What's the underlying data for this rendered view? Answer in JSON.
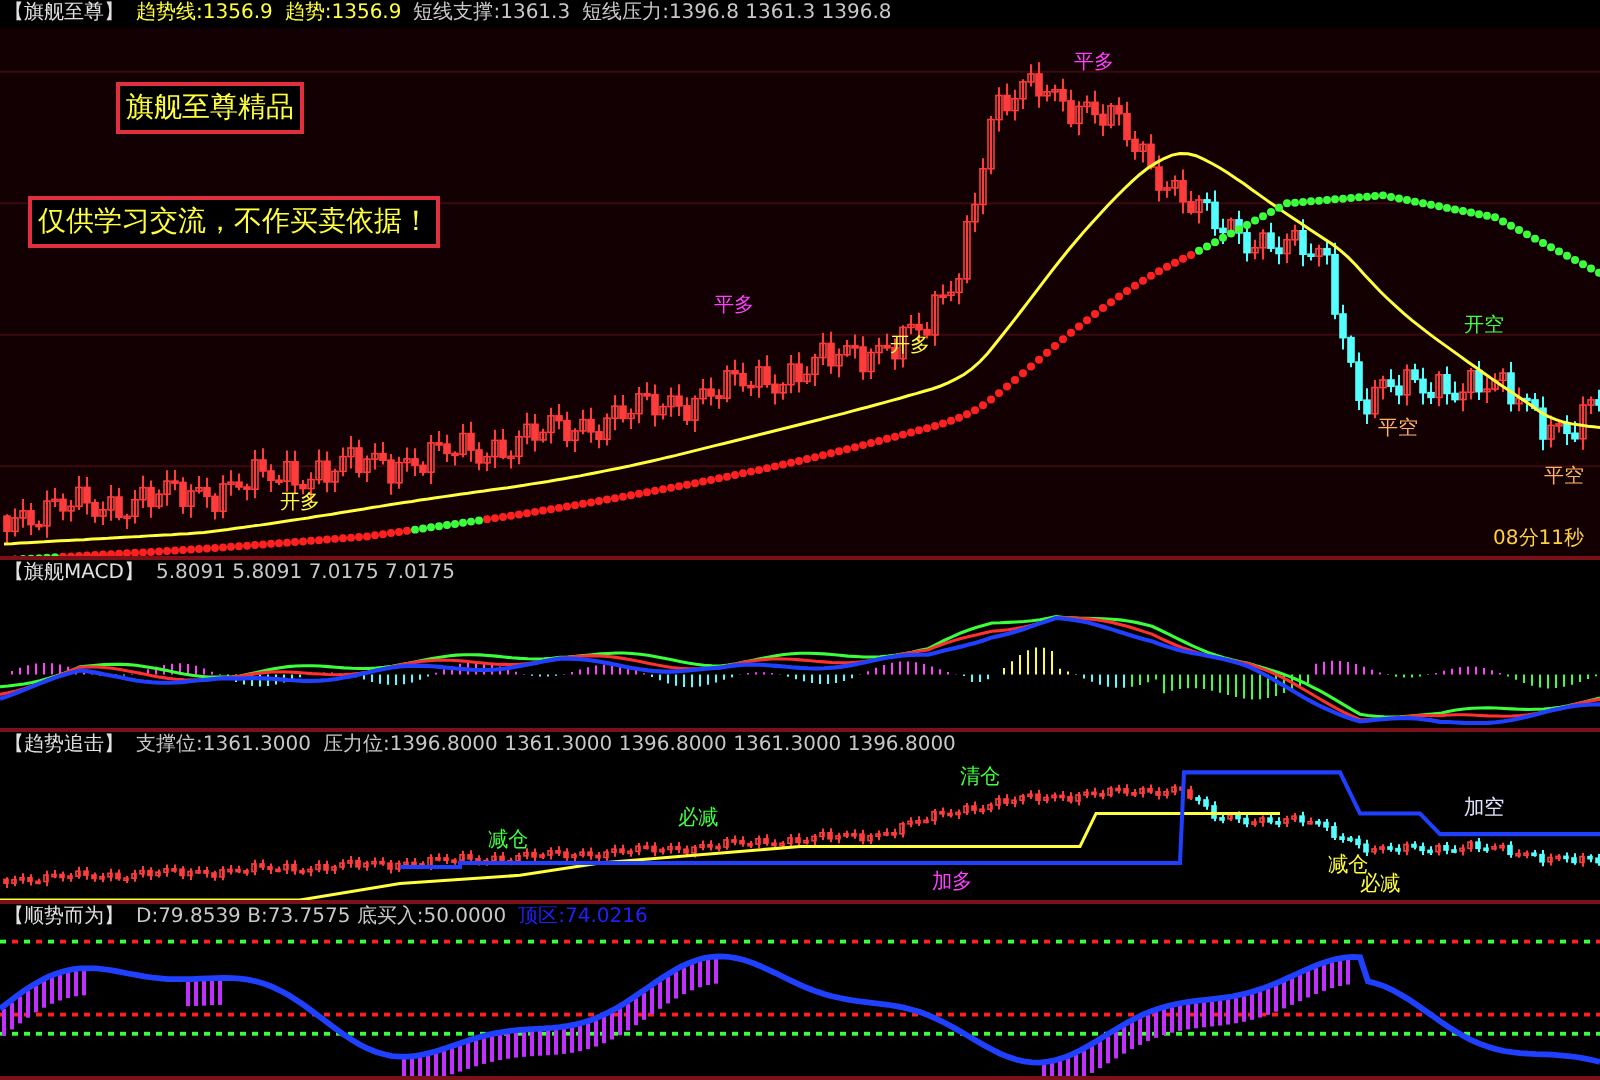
{
  "panels": [
    {
      "kind": "price",
      "header": [
        {
          "text": "【旗舰至尊】",
          "color": "#e0e0e0"
        },
        {
          "text": "趋势线:1356.9",
          "color": "#ffff3c"
        },
        {
          "text": "趋势:1356.9",
          "color": "#ffff3c"
        },
        {
          "text": "短线支撑:1361.3",
          "color": "#c8c8c8"
        },
        {
          "text": "短线压力:1396.8 1361.3 1396.8",
          "color": "#c8c8c8"
        }
      ],
      "notes": [
        "旗舰至尊精品",
        "仅供学习交流，不作买卖依据！"
      ],
      "timer": "08分11秒",
      "signals": [
        {
          "text": "开多",
          "color": "#ffff3c"
        },
        {
          "text": "平多",
          "color": "#ff40ff"
        },
        {
          "text": "开多",
          "color": "#ffff3c"
        },
        {
          "text": "平多",
          "color": "#ff40ff"
        },
        {
          "text": "平空",
          "color": "#ffb060"
        },
        {
          "text": "开空",
          "color": "#40ff40"
        },
        {
          "text": "平空",
          "color": "#ffb060"
        }
      ]
    },
    {
      "kind": "macd",
      "header": [
        {
          "text": "【旗舰MACD】",
          "color": "#e0e0e0"
        },
        {
          "text": "5.8091 5.8091 7.0175 7.0175",
          "color": "#c8c8c8"
        }
      ]
    },
    {
      "kind": "trend",
      "header": [
        {
          "text": "【趋势追击】",
          "color": "#e0e0e0"
        },
        {
          "text": "支撑位:1361.3000",
          "color": "#c8c8c8"
        },
        {
          "text": "压力位:1396.8000 1361.3000 1396.8000 1361.3000 1396.8000",
          "color": "#c8c8c8"
        }
      ],
      "signals": [
        {
          "text": "减仓",
          "color": "#40ff40"
        },
        {
          "text": "必减",
          "color": "#40ff40"
        },
        {
          "text": "清仓",
          "color": "#40ff40"
        },
        {
          "text": "加多",
          "color": "#ff40ff"
        },
        {
          "text": "减仓",
          "color": "#ffff3c"
        },
        {
          "text": "必减",
          "color": "#ffff3c"
        },
        {
          "text": "加空",
          "color": "#e0e0ff"
        }
      ]
    },
    {
      "kind": "wave",
      "header": [
        {
          "text": "【顺势而为】",
          "color": "#e0e0e0"
        },
        {
          "text": "D:79.8539 B:73.7575 底买入:50.0000",
          "color": "#c8c8c8"
        },
        {
          "text": "顶区:74.0216",
          "color": "#2020ff"
        }
      ]
    }
  ]
}
